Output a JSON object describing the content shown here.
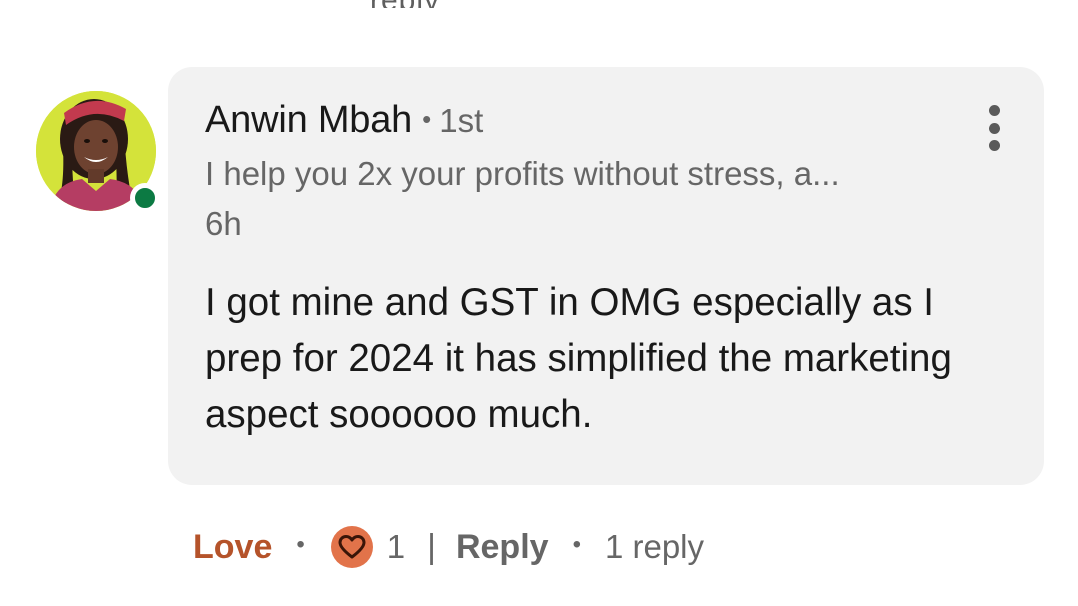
{
  "previous_comment": {
    "fragment": "reply"
  },
  "comment": {
    "author": {
      "name": "Anwin Mbah",
      "separator": "•",
      "degree": "1st",
      "headline": "I help you 2x your profits without stress, a...",
      "online": true
    },
    "time": "6h",
    "text": "I got mine and GST in OMG especially as I prep for 2024 it has simplified the marketing aspect soooooo much.",
    "actions": {
      "reaction_label": "Love",
      "reaction_icon": "heart-icon",
      "reaction_count": "1",
      "divider": "|",
      "reply_label": "Reply",
      "reply_count_text": "1 reply",
      "separator": "•"
    }
  },
  "colors": {
    "love_accent": "#b5532a",
    "reaction_badge": "#e2734a",
    "presence_online": "#0c7a43",
    "bubble_background": "#f2f2f2"
  }
}
